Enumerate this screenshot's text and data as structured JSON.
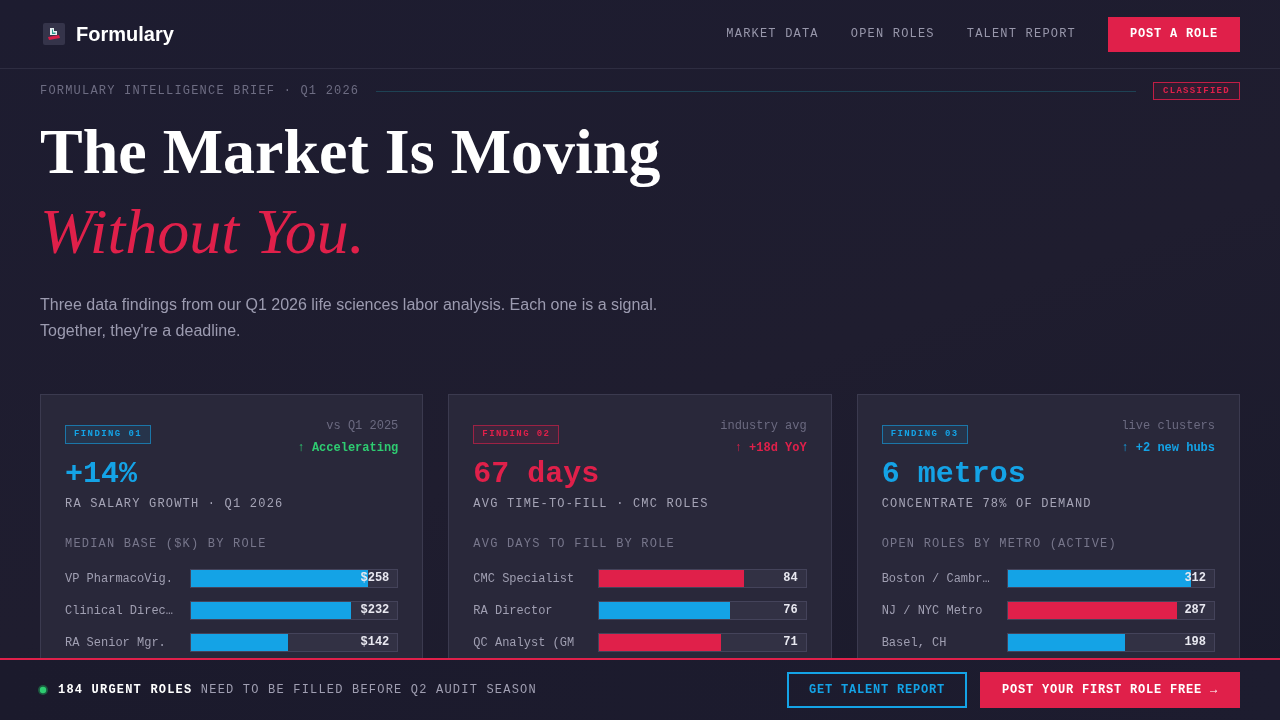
{
  "brand": {
    "name": "Formulary"
  },
  "nav": {
    "links": [
      "MARKET DATA",
      "OPEN ROLES",
      "TALENT REPORT"
    ],
    "button": "POST A ROLE"
  },
  "brief": {
    "label": "FORMULARY INTELLIGENCE BRIEF · Q1 2026",
    "tag": "CLASSIFIED"
  },
  "hero": {
    "title": "The Market Is Moving",
    "title_accent": "Without You.",
    "intro": "Three data findings from our Q1 2026 life sciences labor analysis. Each one is a signal. Together, they're a deadline."
  },
  "findings": [
    {
      "tag": "FINDING 01",
      "color": "#14a3e6",
      "note": "vs Q1 2025",
      "trend": {
        "text": "↑ Accelerating",
        "color": "#2ecc71"
      },
      "value": "+14%",
      "caption": "RA SALARY GROWTH · Q1 2026",
      "chart_title": "MEDIAN BASE ($K) BY ROLE",
      "bars": [
        {
          "label": "VP PharmacoVig.",
          "value": "$258",
          "level": 0.86,
          "color": "#14a3e6"
        },
        {
          "label": "Clinical Direc…",
          "value": "$232",
          "level": 0.774,
          "color": "#14a3e6"
        },
        {
          "label": "RA Senior Mgr.",
          "value": "$142",
          "level": 0.47,
          "color": "#14a3e6"
        }
      ]
    },
    {
      "tag": "FINDING 02",
      "color": "#e0204a",
      "note": "industry avg",
      "trend": {
        "text": "↑ +18d YoY",
        "color": "#e0204a"
      },
      "value": "67 days",
      "caption": "AVG TIME-TO-FILL · CMC ROLES",
      "chart_title": "AVG DAYS TO FILL BY ROLE",
      "bars": [
        {
          "label": "CMC Specialist",
          "value": "84",
          "level": 0.7,
          "color": "#e0204a"
        },
        {
          "label": "RA Director",
          "value": "76",
          "level": 0.635,
          "color": "#14a3e6"
        },
        {
          "label": "QC Analyst (GM",
          "value": "71",
          "level": 0.59,
          "color": "#e0204a"
        }
      ]
    },
    {
      "tag": "FINDING 03",
      "color": "#14a3e6",
      "note": "live clusters",
      "trend": {
        "text": "↑ +2 new hubs",
        "color": "#14a3e6"
      },
      "value": "6 metros",
      "caption": "CONCENTRATE 78% OF DEMAND",
      "chart_title": "OPEN ROLES BY METRO (ACTIVE)",
      "bars": [
        {
          "label": "Boston / Cambr…",
          "value": "312",
          "level": 0.89,
          "color": "#14a3e6"
        },
        {
          "label": "NJ / NYC Metro",
          "value": "287",
          "level": 0.82,
          "color": "#e0204a"
        },
        {
          "label": "Basel, CH",
          "value": "198",
          "level": 0.567,
          "color": "#14a3e6"
        }
      ]
    }
  ],
  "cta_bar": {
    "message": "**184 URGENT ROLES** NEED TO BE FILLED BEFORE Q2 AUDIT SEASON",
    "buttons": [
      {
        "label": "GET TALENT REPORT",
        "kind": "outline"
      },
      {
        "label": "POST YOUR FIRST ROLE FREE →",
        "kind": "solid"
      }
    ]
  }
}
